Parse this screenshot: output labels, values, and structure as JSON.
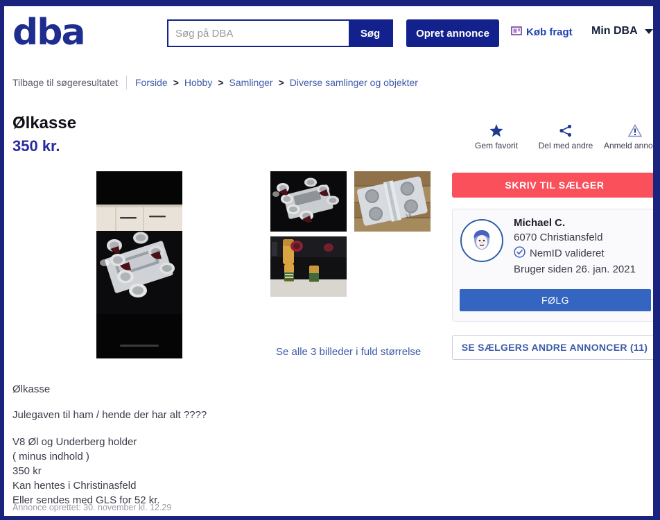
{
  "header": {
    "logo": "dba",
    "search": {
      "value": "",
      "placeholder": "Søg på DBA",
      "button_label": "Søg"
    },
    "create_ad_label": "Opret annonce",
    "shipping_label": "Køb fragt",
    "shipping_icon": "package-icon",
    "my_dba_label": "Min DBA",
    "my_dba_caret_icon": "chevron-down-icon"
  },
  "breadcrumb": {
    "back_label": "Tilbage til søgeresultatet",
    "separator": ">",
    "items": [
      {
        "label": "Forside"
      },
      {
        "label": "Hobby"
      },
      {
        "label": "Samlinger"
      },
      {
        "label": "Diverse samlinger og objekter"
      }
    ]
  },
  "listing": {
    "title": "Ølkasse",
    "price": "350 kr."
  },
  "actions": [
    {
      "label": "Gem favorit",
      "icon": "star-icon"
    },
    {
      "label": "Del med andre",
      "icon": "share-icon"
    },
    {
      "label": "Anmeld annonce",
      "icon": "warning-icon"
    }
  ],
  "gallery": {
    "main_photo_alt": "Ølkasse hovedbillede",
    "thumbnails": [
      {
        "alt": "V8 øl holder med dåser"
      },
      {
        "alt": "V8 holder på træbord"
      },
      {
        "alt": "Underberg flasker"
      }
    ],
    "see_all_label": "Se alle 3 billeder i fuld størrelse"
  },
  "seller": {
    "contact_label": "SKRIV TIL SÆLGER",
    "avatar_icon": "user-avatar-icon",
    "name": "Michael C.",
    "location": "6070 Christiansfeld",
    "validated_label": "NemID valideret",
    "validated_icon": "check-shield-icon",
    "member_since": "Bruger siden 26. jan. 2021",
    "follow_label": "FØLG",
    "other_ads_label": "SE SÆLGERS ANDRE ANNONCER (11)"
  },
  "description": {
    "paragraphs": [
      "Ølkasse",
      "Julegaven til ham / hende der har alt ????"
    ],
    "lines": [
      "V8 Øl og Underberg holder",
      "( minus indhold )",
      "350 kr",
      "Kan hentes i Christinasfeld",
      "Eller sendes med GLS for 52 kr."
    ],
    "created": "Annonce oprettet: 30. november kl. 12.29"
  },
  "colors": {
    "brand_blue": "#13218c",
    "frame_blue": "#1a237e",
    "link_blue": "#3c5ba9",
    "accent_red": "#f9505c",
    "follow_blue": "#3465c0",
    "price_blue": "#2a2a9e"
  }
}
